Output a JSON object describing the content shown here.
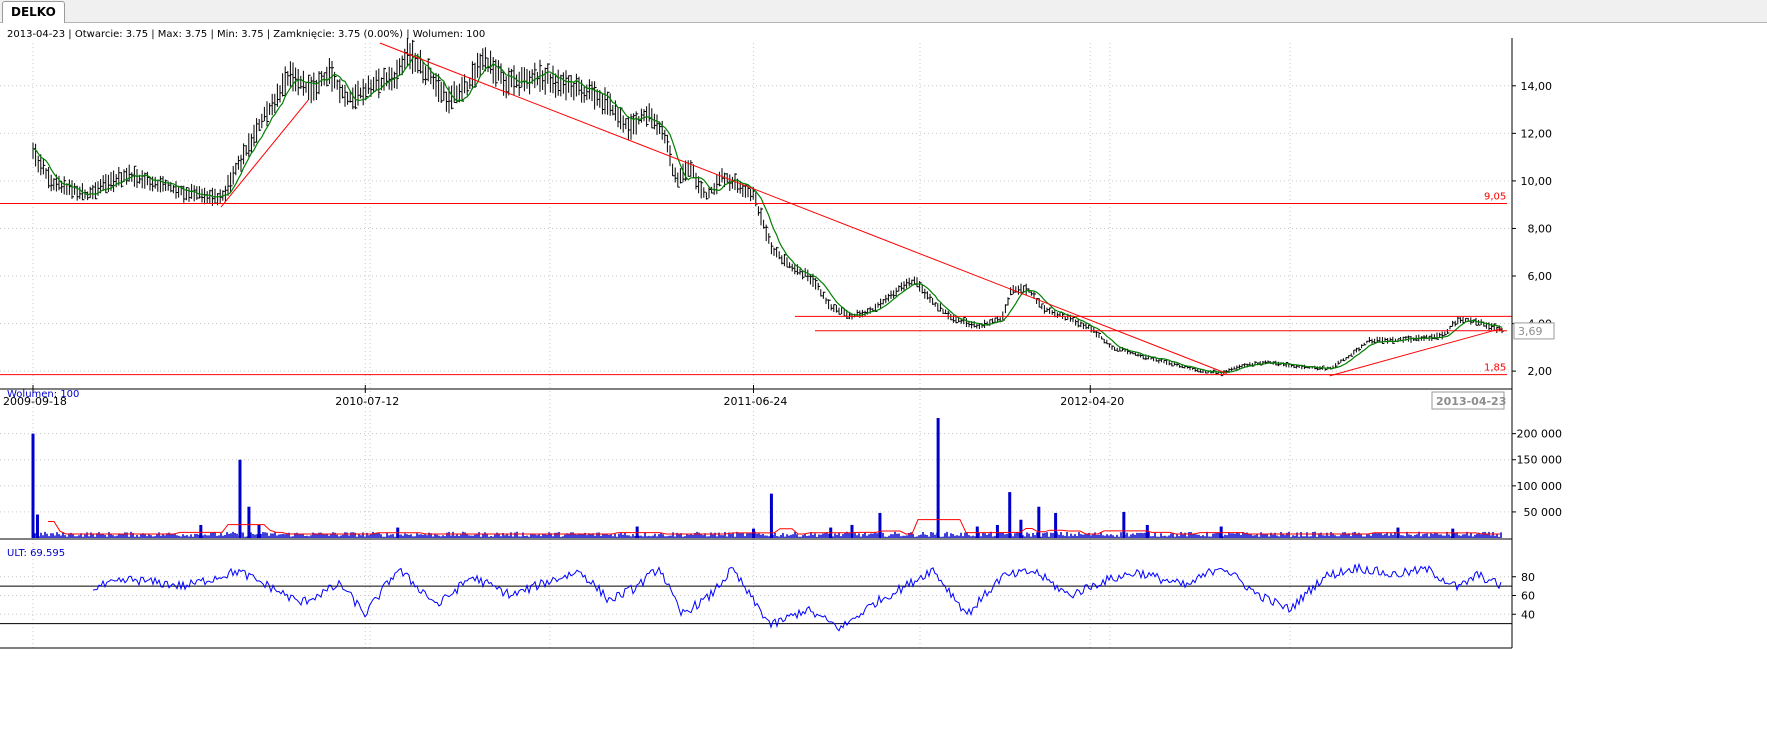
{
  "tab": {
    "label": "DELKO"
  },
  "info_line": "2013-04-23 | Otwarcie: 3.75 | Max: 3.75 | Min: 3.75 | Zamknięcie: 3.75 (0.00%)  | Wolumen: 100",
  "colors": {
    "price": "#000000",
    "ma": "#008000",
    "trendline": "#ff0000",
    "volume": "#0000cc",
    "volume_ma": "#ff0000",
    "ult": "#0000ff",
    "grid": "#c8c8c8"
  },
  "chart_data": [
    {
      "type": "ohlc",
      "title": "2013-04-23 | Otwarcie: 3.75 | Max: 3.75 | Min: 3.75 | Zamknięcie: 3.75 (0.00%)  | Wolumen: 100",
      "x_ticks": [
        "2009-09-18",
        "2010-07-12",
        "2011-06-24",
        "2012-04-20"
      ],
      "x_range": [
        "2009-09-18",
        "2013-04-23"
      ],
      "current_date_label": "2013-04-23",
      "ylim": [
        1.5,
        15.8
      ],
      "y_ticks": [
        2,
        4,
        6,
        8,
        10,
        12,
        14
      ],
      "y_tick_labels": [
        "2,00",
        "4,00",
        "6,00",
        "8,00",
        "10,00",
        "12,00",
        "14,00"
      ],
      "current_price_label": "3,69",
      "series_anchor_points": [
        [
          "2009-09-18",
          11.2
        ],
        [
          "2009-10-05",
          9.9
        ],
        [
          "2009-11-05",
          9.4
        ],
        [
          "2009-12-10",
          10.3
        ],
        [
          "2010-01-25",
          9.6
        ],
        [
          "2010-03-05",
          9.2
        ],
        [
          "2010-04-10",
          12.5
        ],
        [
          "2010-05-05",
          14.4
        ],
        [
          "2010-05-25",
          13.8
        ],
        [
          "2010-06-10",
          14.5
        ],
        [
          "2010-06-25",
          13.5
        ],
        [
          "2010-07-12",
          13.8
        ],
        [
          "2010-08-08",
          14.4
        ],
        [
          "2010-08-20",
          15.4
        ],
        [
          "2010-09-10",
          14.3
        ],
        [
          "2010-09-25",
          13.4
        ],
        [
          "2010-10-12",
          14.0
        ],
        [
          "2010-10-25",
          15.2
        ],
        [
          "2010-11-15",
          14.1
        ],
        [
          "2010-12-15",
          14.4
        ],
        [
          "2011-01-15",
          13.9
        ],
        [
          "2011-02-10",
          13.4
        ],
        [
          "2011-03-05",
          12.2
        ],
        [
          "2011-03-22",
          12.9
        ],
        [
          "2011-04-05",
          12.0
        ],
        [
          "2011-04-15",
          10.1
        ],
        [
          "2011-04-28",
          10.6
        ],
        [
          "2011-05-12",
          9.3
        ],
        [
          "2011-05-28",
          10.2
        ],
        [
          "2011-06-24",
          9.4
        ],
        [
          "2011-07-10",
          7.2
        ],
        [
          "2011-07-25",
          6.5
        ],
        [
          "2011-08-15",
          5.9
        ],
        [
          "2011-09-01",
          4.7
        ],
        [
          "2011-09-20",
          4.3
        ],
        [
          "2011-10-10",
          4.6
        ],
        [
          "2011-11-01",
          5.5
        ],
        [
          "2011-11-15",
          5.8
        ],
        [
          "2011-12-01",
          4.9
        ],
        [
          "2011-12-20",
          4.2
        ],
        [
          "2012-01-10",
          3.9
        ],
        [
          "2012-02-01",
          4.2
        ],
        [
          "2012-02-10",
          5.5
        ],
        [
          "2012-02-25",
          5.4
        ],
        [
          "2012-03-10",
          4.6
        ],
        [
          "2012-04-01",
          4.2
        ],
        [
          "2012-04-20",
          3.8
        ],
        [
          "2012-05-10",
          3.0
        ],
        [
          "2012-06-15",
          2.5
        ],
        [
          "2012-07-20",
          2.1
        ],
        [
          "2012-08-15",
          1.9
        ],
        [
          "2012-09-01",
          2.2
        ],
        [
          "2012-09-25",
          2.4
        ],
        [
          "2012-10-20",
          2.2
        ],
        [
          "2012-11-20",
          2.1
        ],
        [
          "2012-12-10",
          2.7
        ],
        [
          "2012-12-25",
          3.3
        ],
        [
          "2013-01-20",
          3.3
        ],
        [
          "2013-02-15",
          3.4
        ],
        [
          "2013-03-01",
          3.5
        ],
        [
          "2013-03-15",
          4.2
        ],
        [
          "2013-03-28",
          4.1
        ],
        [
          "2013-04-12",
          3.9
        ],
        [
          "2013-04-23",
          3.7
        ]
      ],
      "horizontal_levels": [
        {
          "value": 9.05,
          "label": "9,05"
        },
        {
          "value": 1.85,
          "label": "1,85"
        },
        {
          "value": 4.3,
          "label": ""
        },
        {
          "value": 3.7,
          "label": ""
        }
      ],
      "trendlines": [
        {
          "from": [
            "2010-03-05",
            8.9
          ],
          "to": [
            "2010-05-22",
            13.4
          ]
        },
        {
          "from": [
            "2010-07-25",
            15.8
          ],
          "to": [
            "2012-08-20",
            1.9
          ]
        },
        {
          "from": [
            "2012-11-20",
            1.8
          ],
          "to": [
            "2013-04-23",
            3.8
          ]
        }
      ]
    },
    {
      "type": "bar",
      "title": "Wolumen: 100",
      "ylim": [
        0,
        230000
      ],
      "y_ticks": [
        50000,
        100000,
        150000,
        200000
      ],
      "y_tick_labels": [
        "50 000",
        "100 000",
        "150 000",
        "200 000"
      ],
      "spikes": [
        [
          "2009-09-18",
          200000
        ],
        [
          "2009-09-22",
          45000
        ],
        [
          "2010-02-15",
          25000
        ],
        [
          "2010-03-22",
          150000
        ],
        [
          "2010-03-30",
          60000
        ],
        [
          "2010-04-08",
          25000
        ],
        [
          "2010-08-10",
          20000
        ],
        [
          "2011-03-12",
          22000
        ],
        [
          "2011-06-24",
          18000
        ],
        [
          "2011-07-10",
          85000
        ],
        [
          "2011-09-01",
          20000
        ],
        [
          "2011-09-20",
          25000
        ],
        [
          "2011-10-15",
          48000
        ],
        [
          "2011-12-06",
          230000
        ],
        [
          "2012-01-10",
          22000
        ],
        [
          "2012-01-28",
          25000
        ],
        [
          "2012-02-08",
          88000
        ],
        [
          "2012-02-18",
          35000
        ],
        [
          "2012-03-05",
          60000
        ],
        [
          "2012-03-20",
          48000
        ],
        [
          "2012-05-20",
          50000
        ],
        [
          "2012-06-10",
          25000
        ],
        [
          "2012-08-15",
          22000
        ],
        [
          "2013-01-20",
          20000
        ],
        [
          "2013-03-10",
          18000
        ]
      ],
      "baseline_volume": 7000
    },
    {
      "type": "line",
      "title": "ULT: 69.595",
      "ylim": [
        20,
        100
      ],
      "y_ticks": [
        40,
        60,
        80
      ],
      "y_tick_labels": [
        "40",
        "60",
        "80"
      ],
      "reference_lines": [
        70,
        30
      ],
      "anchor_points": [
        [
          "2009-11-10",
          68
        ],
        [
          "2009-12-15",
          77
        ],
        [
          "2010-02-01",
          70
        ],
        [
          "2010-03-20",
          86
        ],
        [
          "2010-04-20",
          68
        ],
        [
          "2010-05-15",
          52
        ],
        [
          "2010-06-20",
          72
        ],
        [
          "2010-07-12",
          40
        ],
        [
          "2010-08-10",
          88
        ],
        [
          "2010-09-15",
          50
        ],
        [
          "2010-10-15",
          80
        ],
        [
          "2010-11-20",
          60
        ],
        [
          "2010-12-20",
          74
        ],
        [
          "2011-01-20",
          86
        ],
        [
          "2011-02-15",
          55
        ],
        [
          "2011-03-10",
          68
        ],
        [
          "2011-04-01",
          90
        ],
        [
          "2011-04-20",
          40
        ],
        [
          "2011-05-15",
          58
        ],
        [
          "2011-06-05",
          88
        ],
        [
          "2011-06-24",
          54
        ],
        [
          "2011-07-10",
          28
        ],
        [
          "2011-08-10",
          45
        ],
        [
          "2011-09-10",
          25
        ],
        [
          "2011-10-10",
          52
        ],
        [
          "2011-11-10",
          72
        ],
        [
          "2011-12-01",
          88
        ],
        [
          "2012-01-01",
          40
        ],
        [
          "2012-02-01",
          80
        ],
        [
          "2012-03-01",
          86
        ],
        [
          "2012-04-01",
          60
        ],
        [
          "2012-05-01",
          75
        ],
        [
          "2012-06-01",
          85
        ],
        [
          "2012-07-15",
          70
        ],
        [
          "2012-08-15",
          92
        ],
        [
          "2012-09-15",
          62
        ],
        [
          "2012-10-15",
          45
        ],
        [
          "2012-11-15",
          80
        ],
        [
          "2012-12-15",
          90
        ],
        [
          "2013-01-15",
          82
        ],
        [
          "2013-02-15",
          88
        ],
        [
          "2013-03-15",
          68
        ],
        [
          "2013-04-01",
          82
        ],
        [
          "2013-04-23",
          70
        ]
      ]
    }
  ]
}
